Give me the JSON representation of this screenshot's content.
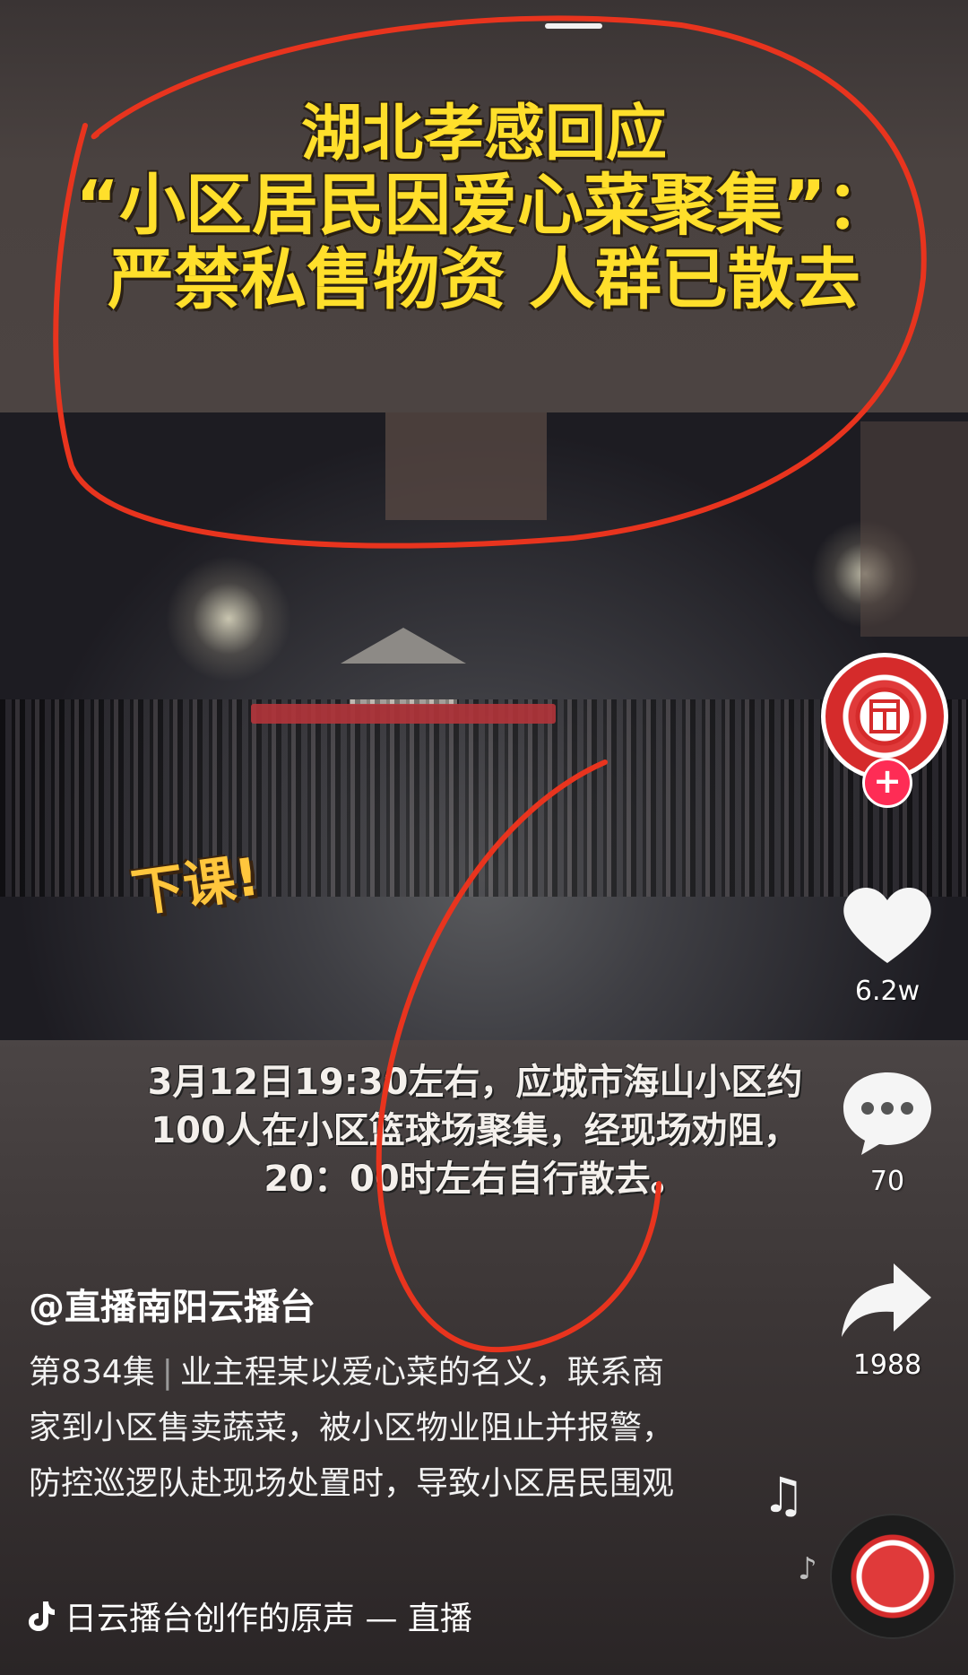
{
  "video": {
    "headline": {
      "line1": "湖北孝感回应",
      "line2": "“小区居民因爱心菜聚集”：",
      "line3": "严禁私售物资 人群已散去"
    },
    "sticker_text": "下课!",
    "caption": {
      "line1": "3月12日19:30左右，应城市海山小区约",
      "line2": "100人在小区篮球场聚集，经现场劝阻，",
      "line3": "20：00时左右自行散去。"
    }
  },
  "actions": {
    "likes": "6.2w",
    "comments": "70",
    "shares": "1988",
    "follow_symbol": "+"
  },
  "post": {
    "handle": "@直播南阳云播台",
    "episode": "第834集",
    "separator": "|",
    "description": "业主程某以爱心菜的名义，联系商家到小区售卖蔬菜，被小区物业阻止并报警，防控巡逻队赴现场处置时，导致小区居民围观",
    "music": "日云播台创作的原声 — 直播"
  },
  "icons": [
    "heart-icon",
    "comment-icon",
    "share-icon",
    "music-note-icon",
    "tiktok-logo-icon",
    "music-disc-icon"
  ],
  "colors": {
    "headline": "#ffdf2b",
    "follow": "#fe2c55",
    "annotation": "#e8341e"
  }
}
